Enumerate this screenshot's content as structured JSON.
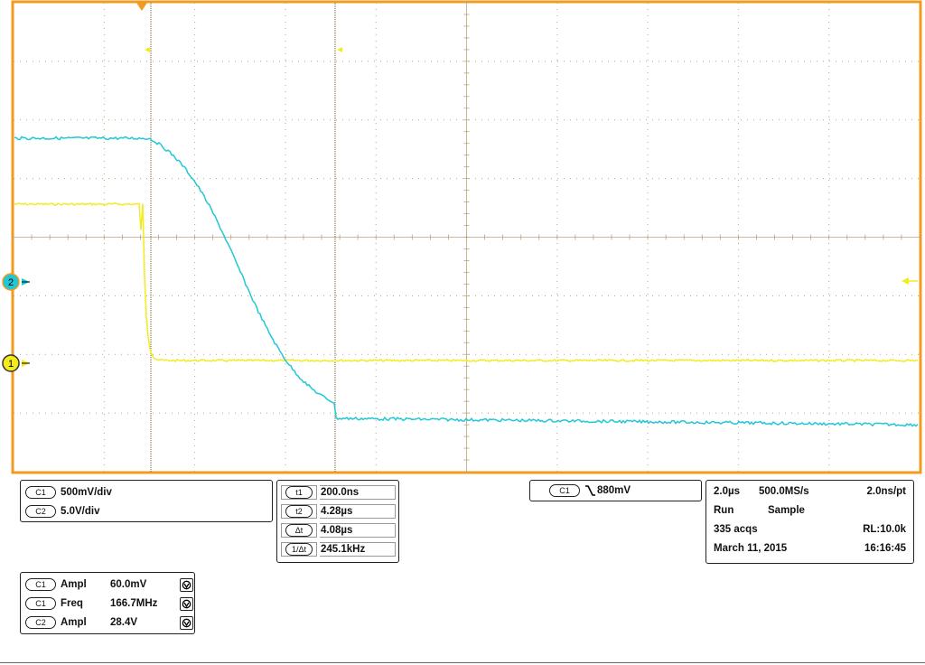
{
  "colors": {
    "frame": "#f39b1f",
    "grid": "#bda27c",
    "ch1_trace": "#f2ec1c",
    "ch2_trace": "#22c7d6",
    "cursor": "#7a5a20",
    "panel_border": "#222222"
  },
  "markers": {
    "ch2_marker": "2",
    "ch1_marker": "1"
  },
  "icons": [
    "trigger-position-icon",
    "cursor-marker-icon",
    "trigger-level-arrow-icon",
    "falling-edge-icon",
    "measure-icon"
  ],
  "channels": [
    {
      "tag": "C1",
      "scale": "500mV/div"
    },
    {
      "tag": "C2",
      "scale": "5.0V/div"
    }
  ],
  "cursors": [
    {
      "tag": "t1",
      "value": "200.0ns"
    },
    {
      "tag": "t2",
      "value": "4.28µs"
    },
    {
      "tag": "Δt",
      "value": "4.08µs"
    },
    {
      "tag": "1/Δt",
      "value": "245.1kHz"
    }
  ],
  "trigger": {
    "source": "C1",
    "level": "880mV"
  },
  "horizontal": {
    "timebase": "2.0µs",
    "sample_rate": "500.0MS/s",
    "resolution": "2.0ns/pt",
    "run_state": "Run",
    "mode": "Sample",
    "acquisitions": "335 acqs",
    "record_length": "RL:10.0k",
    "date": "March 11, 2015",
    "time": "16:16:45"
  },
  "measurements": [
    {
      "tag": "C1",
      "name": "Ampl",
      "value": "60.0mV"
    },
    {
      "tag": "C1",
      "name": "Freq",
      "value": "166.7MHz"
    },
    {
      "tag": "C2",
      "name": "Ampl",
      "value": "28.4V"
    }
  ]
}
